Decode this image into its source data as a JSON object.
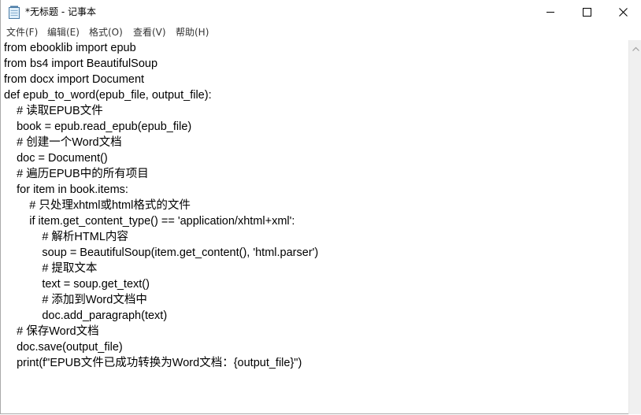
{
  "window": {
    "title": "*无标题 - 记事本",
    "icon": "notepad-icon",
    "controls": {
      "minimize": "minimize-icon",
      "maximize": "maximize-icon",
      "close": "close-icon"
    }
  },
  "menu": [
    "文件(F)",
    "编辑(E)",
    "格式(O)",
    "查看(V)",
    "帮助(H)"
  ],
  "editor": {
    "lines": [
      "from ebooklib import epub",
      "from bs4 import BeautifulSoup",
      "from docx import Document",
      "def epub_to_word(epub_file, output_file):",
      "    # 读取EPUB文件",
      "    book = epub.read_epub(epub_file)",
      "    # 创建一个Word文档",
      "    doc = Document()",
      "    # 遍历EPUB中的所有项目",
      "    for item in book.items:",
      "        # 只处理xhtml或html格式的文件",
      "        if item.get_content_type() == 'application/xhtml+xml':",
      "            # 解析HTML内容",
      "            soup = BeautifulSoup(item.get_content(), 'html.parser')",
      "            # 提取文本",
      "            text = soup.get_text()",
      "            # 添加到Word文档中",
      "            doc.add_paragraph(text)",
      "    # 保存Word文档",
      "    doc.save(output_file)",
      "    print(f\"EPUB文件已成功转换为Word文档：{output_file}\")"
    ]
  },
  "scrollbar": {
    "up_arrow": "scroll-up-arrow-icon"
  }
}
